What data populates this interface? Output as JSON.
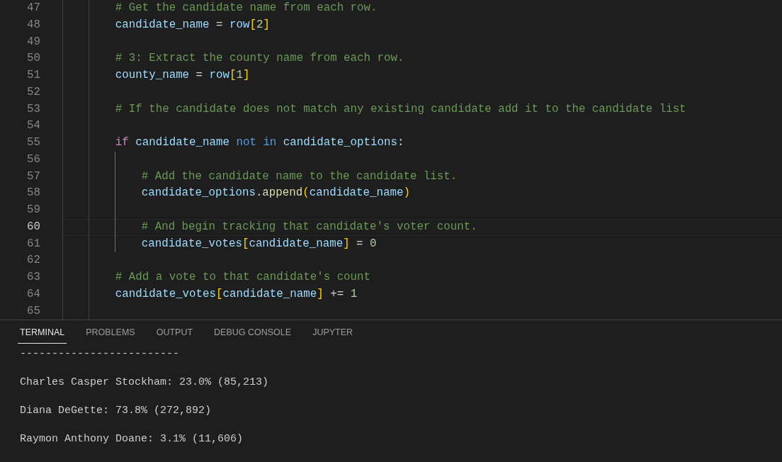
{
  "editor": {
    "lines": [
      {
        "number": "47",
        "current": false,
        "tokens": [
          {
            "kind": "comment",
            "text": "# Get the candidate name from each row."
          }
        ]
      },
      {
        "number": "48",
        "current": false,
        "tokens": [
          {
            "kind": "variable",
            "text": "candidate_name"
          },
          {
            "kind": "operator",
            "text": " = "
          },
          {
            "kind": "variable",
            "text": "row"
          },
          {
            "kind": "bracket",
            "text": "["
          },
          {
            "kind": "number",
            "text": "2"
          },
          {
            "kind": "bracket",
            "text": "]"
          }
        ]
      },
      {
        "number": "49",
        "current": false
      },
      {
        "number": "50",
        "current": false,
        "tokens": [
          {
            "kind": "comment",
            "text": "# 3: Extract the county name from each row."
          }
        ]
      },
      {
        "number": "51",
        "current": false,
        "tokens": [
          {
            "kind": "variable",
            "text": "county_name"
          },
          {
            "kind": "operator",
            "text": " = "
          },
          {
            "kind": "variable",
            "text": "row"
          },
          {
            "kind": "bracket",
            "text": "["
          },
          {
            "kind": "number",
            "text": "1"
          },
          {
            "kind": "bracket",
            "text": "]"
          }
        ]
      },
      {
        "number": "52",
        "current": false
      },
      {
        "number": "53",
        "current": false,
        "tokens": [
          {
            "kind": "comment",
            "text": "# If the candidate does not match any existing candidate add it to the candidate list"
          }
        ]
      },
      {
        "number": "54",
        "current": false
      },
      {
        "number": "55",
        "current": false,
        "tokens": [
          {
            "kind": "control",
            "text": "if "
          },
          {
            "kind": "variable",
            "text": "candidate_name "
          },
          {
            "kind": "keyword",
            "text": "not in "
          },
          {
            "kind": "variable",
            "text": "candidate_options"
          },
          {
            "kind": "operator",
            "text": ":"
          }
        ],
        "children": [
          {
            "number": "56",
            "current": false
          },
          {
            "number": "57",
            "current": false,
            "tokens": [
              {
                "kind": "comment",
                "text": "# Add the candidate name to the candidate list."
              }
            ]
          },
          {
            "number": "58",
            "current": false,
            "tokens": [
              {
                "kind": "variable",
                "text": "candidate_options"
              },
              {
                "kind": "operator",
                "text": "."
              },
              {
                "kind": "function",
                "text": "append"
              },
              {
                "kind": "bracket",
                "text": "("
              },
              {
                "kind": "variable",
                "text": "candidate_name"
              },
              {
                "kind": "bracket",
                "text": ")"
              }
            ]
          },
          {
            "number": "59",
            "current": false
          },
          {
            "number": "60",
            "current": true,
            "tokens": [
              {
                "kind": "comment",
                "text": "# And begin tracking that candidate's voter count."
              }
            ]
          },
          {
            "number": "61",
            "current": false,
            "tokens": [
              {
                "kind": "variable",
                "text": "candidate_votes"
              },
              {
                "kind": "bracket",
                "text": "["
              },
              {
                "kind": "variable",
                "text": "candidate_name"
              },
              {
                "kind": "bracket",
                "text": "]"
              },
              {
                "kind": "operator",
                "text": " = "
              },
              {
                "kind": "number",
                "text": "0"
              }
            ]
          }
        ]
      },
      {
        "number": "62",
        "current": false
      },
      {
        "number": "63",
        "current": false,
        "tokens": [
          {
            "kind": "comment",
            "text": "# Add a vote to that candidate's count"
          }
        ]
      },
      {
        "number": "64",
        "current": false,
        "tokens": [
          {
            "kind": "variable",
            "text": "candidate_votes"
          },
          {
            "kind": "bracket",
            "text": "["
          },
          {
            "kind": "variable",
            "text": "candidate_name"
          },
          {
            "kind": "bracket",
            "text": "]"
          },
          {
            "kind": "operator",
            "text": " += "
          },
          {
            "kind": "number",
            "text": "1"
          }
        ]
      },
      {
        "number": "65",
        "current": false
      }
    ]
  },
  "panel": {
    "tabs": [
      {
        "label": "TERMINAL",
        "selected": true
      },
      {
        "label": "PROBLEMS",
        "selected": false
      },
      {
        "label": "OUTPUT",
        "selected": false
      },
      {
        "label": "DEBUG CONSOLE",
        "selected": false
      },
      {
        "label": "JUPYTER",
        "selected": false
      }
    ],
    "terminal": {
      "lines": [
        "-------------------------",
        "Charles Casper Stockham: 23.0% (85,213)",
        "Diana DeGette: 73.8% (272,892)",
        "Raymon Anthony Doane: 3.1% (11,606)"
      ]
    }
  }
}
